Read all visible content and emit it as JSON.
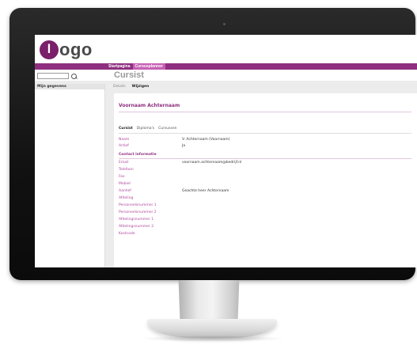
{
  "app": {
    "logo_letter": "l",
    "logo_text": "ogo",
    "brand_color": "#8e2f80",
    "accent_color": "#c65fb3"
  },
  "topnav": {
    "items": [
      {
        "label": "Startpagina",
        "active": false
      },
      {
        "label": "Cursusplanner",
        "active": true
      }
    ]
  },
  "search": {
    "placeholder": "",
    "icon": "search-icon"
  },
  "page": {
    "title": "Cursist"
  },
  "sidebar": {
    "header": "Mijn gegevens"
  },
  "subtabs": [
    {
      "label": "Details",
      "active": false
    },
    {
      "label": "Wijzigen",
      "active": true
    }
  ],
  "person": {
    "name": "Voornaam Achternaam"
  },
  "tabs": [
    {
      "label": "Cursist",
      "active": true
    },
    {
      "label": "Diploma's",
      "active": false
    },
    {
      "label": "Cursussen",
      "active": false
    }
  ],
  "fields": [
    {
      "label": "Naam",
      "value": "V. Achternaam (Voornaam)"
    },
    {
      "label": "Actief",
      "value": "Ja"
    }
  ],
  "contact": {
    "title": "Contact informatie",
    "fields": [
      {
        "label": "Email",
        "value": "voornaam.achternaam@bedrijf.nl"
      },
      {
        "label": "Telefoon",
        "value": ""
      },
      {
        "label": "Fax",
        "value": ""
      },
      {
        "label": "Mobiel",
        "value": ""
      },
      {
        "label": "Aanhef",
        "value": "Geachte heer Achternaam"
      },
      {
        "label": "Afdeling",
        "value": ""
      },
      {
        "label": "Personeelsnummer 1",
        "value": ""
      },
      {
        "label": "Personeelsnummer 2",
        "value": ""
      },
      {
        "label": "Afdelingsnummer 1",
        "value": ""
      },
      {
        "label": "Afdelingsnummer 2",
        "value": ""
      },
      {
        "label": "Kostcode",
        "value": ""
      }
    ]
  }
}
